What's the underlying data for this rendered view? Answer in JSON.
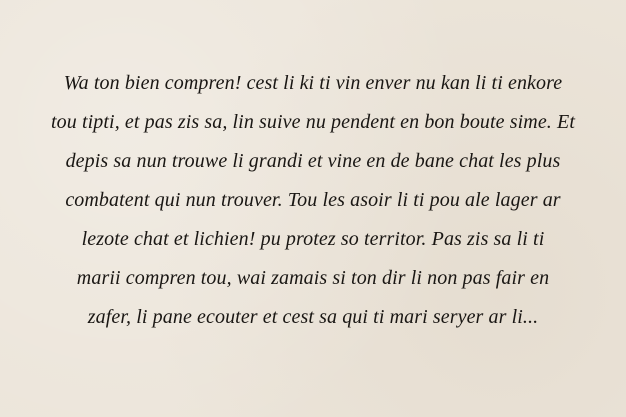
{
  "passage": {
    "lines": [
      "Wa ton bien compren! cest li ki ti vin enver nu kan li ti enkore",
      "tou tipti, et pas zis sa, lin suive nu pendent en bon boute sime. Et",
      "depis sa nun trouwe li grandi et vine en de bane chat les plus",
      "combatent qui nun trouver. Tou les asoir li ti pou ale lager ar",
      "lezote chat et lichien! pu protez so territor. Pas zis sa li  ti",
      "marii compren tou, wai zamais si ton dir li non pas fair en",
      "zafer, li pane ecouter et cest sa qui ti mari seryer ar li..."
    ]
  }
}
